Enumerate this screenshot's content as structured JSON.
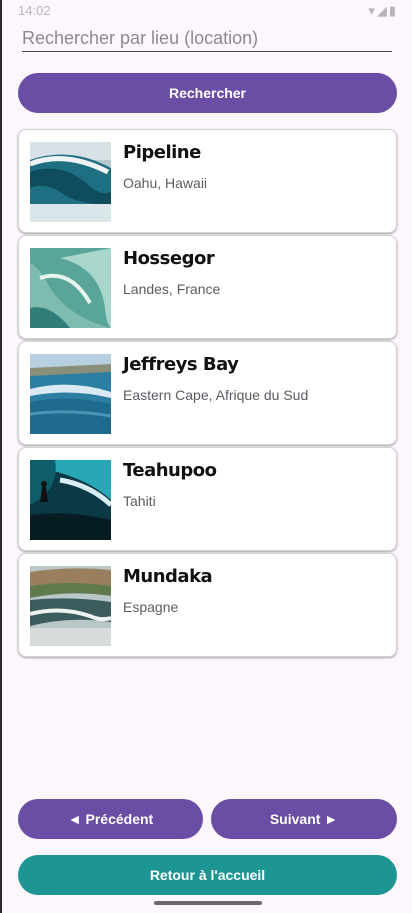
{
  "status": {
    "time": "14:02",
    "icons": "▾◢▮"
  },
  "search": {
    "placeholder": "Rechercher par lieu (location)",
    "button_label": "Rechercher"
  },
  "spots": [
    {
      "name": "Pipeline",
      "location": "Oahu, Hawaii",
      "image": "barrel-wave-photo"
    },
    {
      "name": "Hossegor",
      "location": "Landes, France",
      "image": "curling-wave-photo"
    },
    {
      "name": "Jeffreys Bay",
      "location": "Eastern Cape, Afrique du Sud",
      "image": "coastline-wave-photo"
    },
    {
      "name": "Teahupoo",
      "location": "Tahiti",
      "image": "surfer-photo"
    },
    {
      "name": "Mundaka",
      "location": "Espagne",
      "image": "river-mouth-wave-photo"
    }
  ],
  "pagination": {
    "prev_label": "◄ Précédent",
    "next_label": "Suivant ►"
  },
  "home_label": "Retour à l'accueil",
  "colors": {
    "primary": "#6a4ea6",
    "secondary": "#1d9592",
    "background": "#fdf7fd"
  }
}
